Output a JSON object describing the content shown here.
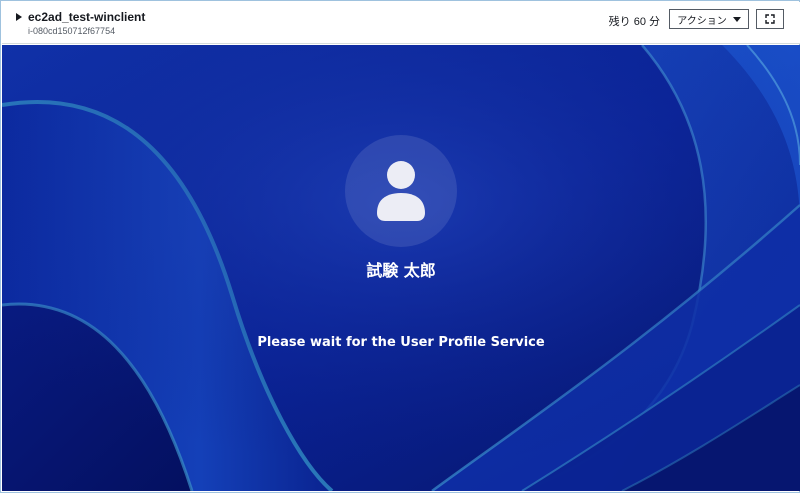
{
  "header": {
    "instance_name": "ec2ad_test-winclient",
    "instance_id": "i-080cd150712f67754",
    "time_remaining": "残り 60 分",
    "actions_label": "アクション"
  },
  "login_screen": {
    "user_name": "試験 太郎",
    "status_message": "Please wait for the User Profile Service"
  },
  "icons": {
    "expand": "caret-right-icon",
    "actions_dropdown": "caret-down-icon",
    "fullscreen": "fullscreen-icon",
    "avatar": "user-avatar-icon"
  },
  "colors": {
    "wallpaper_base": "#0a1f8a",
    "wallpaper_accent": "#2f86c0",
    "text_on_wallpaper": "#ffffff"
  }
}
